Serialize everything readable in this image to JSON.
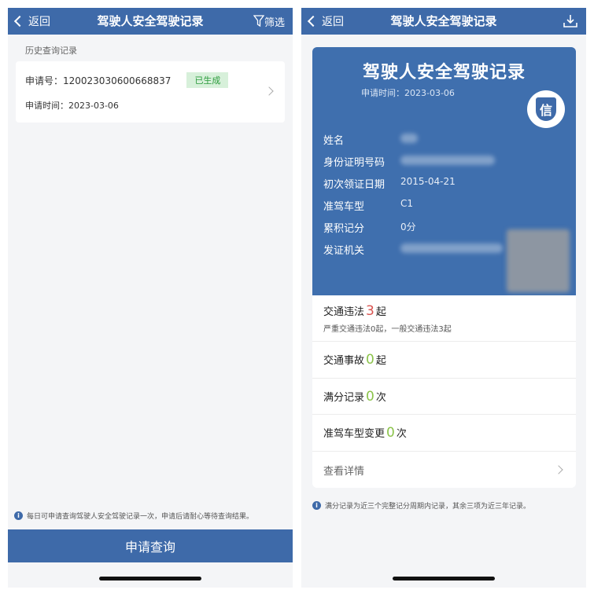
{
  "left": {
    "nav": {
      "back": "返回",
      "title": "驾驶人安全驾驶记录",
      "filter": "筛选"
    },
    "section_title": "历史查询记录",
    "record": {
      "application_no": "申请号：120023030600668837",
      "status": "已生成",
      "application_time": "申请时间：2023-03-06"
    },
    "note": "每日可申请查询驾驶人安全驾驶记录一次，申请后请耐心等待查询结果。",
    "apply_button": "申请查询"
  },
  "right": {
    "nav": {
      "back": "返回",
      "title": "驾驶人安全驾驶记录"
    },
    "card": {
      "title": "驾驶人安全驾驶记录",
      "date": "申请时间：2023-03-06",
      "seal_char": "信",
      "fields": [
        {
          "label": "姓名",
          "value": ""
        },
        {
          "label": "身份证明号码",
          "value": ""
        },
        {
          "label": "初次领证日期",
          "value": "2015-04-21"
        },
        {
          "label": "准驾车型",
          "value": "C1"
        },
        {
          "label": "累积记分",
          "value": "0分"
        },
        {
          "label": "发证机关",
          "value": ""
        }
      ]
    },
    "stats": {
      "violations": {
        "label": "交通违法",
        "count": "3",
        "unit": "起",
        "sub": "严重交通违法0起，一般交通违法3起"
      },
      "accidents": {
        "label": "交通事故",
        "count": "0",
        "unit": "起"
      },
      "full_score": {
        "label": "满分记录",
        "count": "0",
        "unit": "次"
      },
      "class_change": {
        "label": "准驾车型变更",
        "count": "0",
        "unit": "次"
      },
      "detail": "查看详情"
    },
    "note": "满分记录为近三个完整记分周期内记录，其余三项为近三年记录。"
  },
  "colors": {
    "primary": "#3e6aa9",
    "card": "#3f6fae",
    "status_green": "#2c9c3d",
    "count_red": "#d9534f",
    "count_green": "#8bc34a"
  }
}
